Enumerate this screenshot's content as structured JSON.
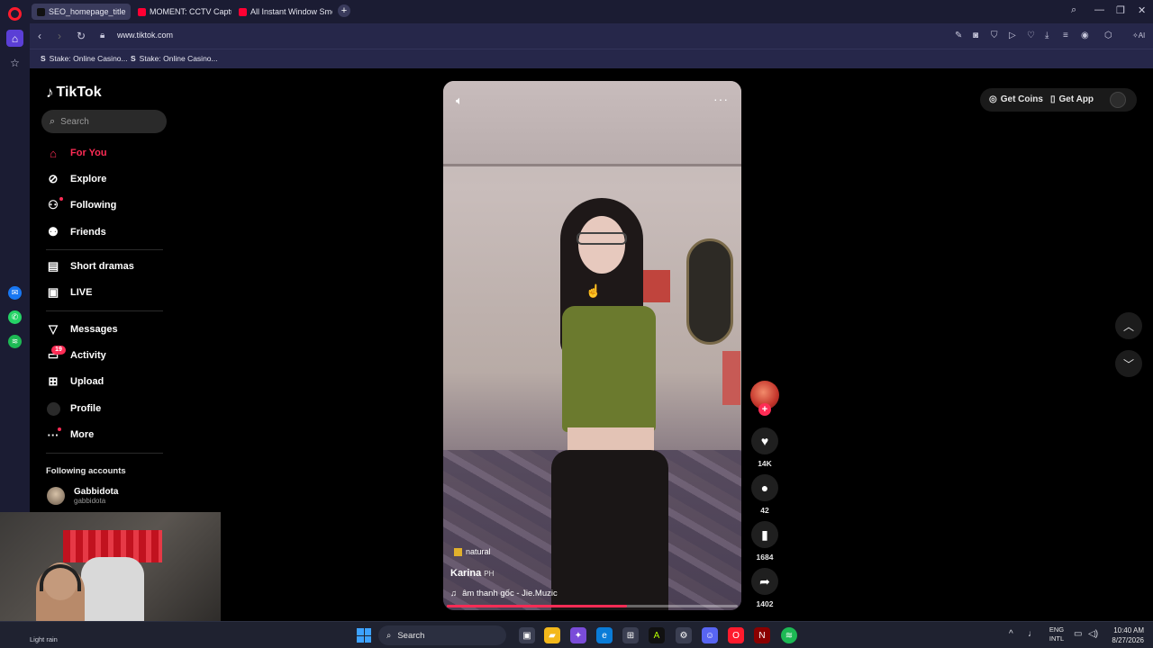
{
  "browser": {
    "tabs": [
      {
        "label": "SEO_homepage_title",
        "color": "#3a3b5c"
      },
      {
        "label": "MOMENT: CCTV Captures",
        "color": "#ff0033"
      },
      {
        "label": "All Instant Window Smoke",
        "color": "#ff0033"
      }
    ],
    "url": "www.tiktok.com",
    "bookmarks": [
      "Stake: Online Casino...",
      "Stake: Online Casino..."
    ]
  },
  "tiktok": {
    "logo": "TikTok",
    "search_placeholder": "Search",
    "nav": [
      {
        "label": "For You",
        "icon": "home-icon",
        "active": true
      },
      {
        "label": "Explore",
        "icon": "compass-icon"
      },
      {
        "label": "Following",
        "icon": "following-icon"
      },
      {
        "label": "Friends",
        "icon": "friends-icon"
      },
      {
        "label": "Short dramas",
        "icon": "film-icon"
      },
      {
        "label": "LIVE",
        "icon": "live-icon"
      },
      {
        "label": "Messages",
        "icon": "send-icon"
      },
      {
        "label": "Activity",
        "icon": "activity-icon",
        "badge": "19"
      },
      {
        "label": "Upload",
        "icon": "upload-icon"
      },
      {
        "label": "Profile",
        "icon": "profile-avatar"
      },
      {
        "label": "More",
        "icon": "more-icon"
      }
    ],
    "following_title": "Following accounts",
    "following": [
      {
        "name": "Gabbidota",
        "handle": "gabbidota"
      }
    ],
    "top_right": {
      "coins": "Get Coins",
      "app": "Get App"
    },
    "video": {
      "tag": "natural",
      "author": "Karina",
      "author_flag": "PH",
      "music": "âm thanh gốc - Jie.Muzic",
      "progress": 0.62
    },
    "actions": {
      "likes": "14K",
      "comments": "42",
      "saves": "1684",
      "shares": "1402"
    }
  },
  "taskbar": {
    "weather": "Light rain",
    "search": "Search",
    "lang_top": "ENG",
    "lang_bottom": "INTL",
    "time": "10:40 AM",
    "date": "8/27/2026"
  },
  "colors": {
    "tiktok_accent": "#fe2c55",
    "browser_bg": "#1b1c33"
  }
}
